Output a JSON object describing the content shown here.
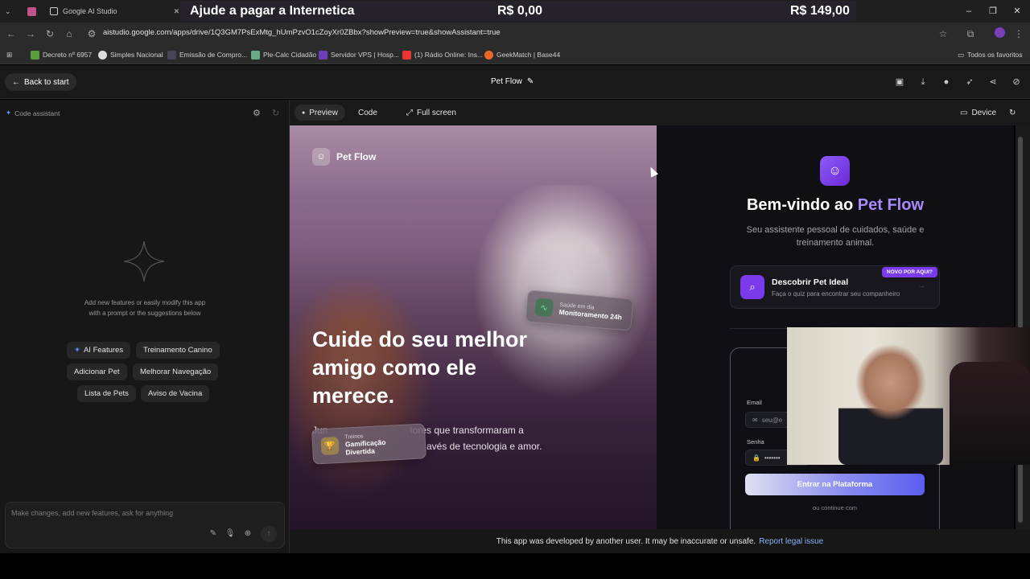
{
  "browser": {
    "tab_title": "Google AI Studio",
    "banner": {
      "text": "Ajude a pagar a Internetica",
      "amount1": "R$ 0,00",
      "amount2": "R$ 149,00"
    },
    "url": "aistudio.google.com/apps/drive/1Q3GM7PsExMtg_hUmPzvO1cZoyXr0ZBbx?showPreview=true&showAssistant=true",
    "bookmarks": [
      "Decreto nº 6957",
      "Simples Nacional",
      "Emissão de Compro...",
      "Ple-Calc Cidadão",
      "Servidor VPS | Hosp...",
      "(1) Rádio Online: Ins...",
      "GeekMatch | Base44"
    ],
    "all_bookmarks": "Todos os favoritos"
  },
  "app": {
    "back_label": "Back to start",
    "title": "Pet Flow"
  },
  "left": {
    "assistant_label": "Code assistant",
    "empty_text": "Add new features or easily modify this app with a prompt or the suggestions below",
    "chips": [
      "AI Features",
      "Treinamento Canino",
      "Adicionar Pet",
      "Melhorar Navegação",
      "Lista de Pets",
      "Aviso de Vacina"
    ],
    "prompt_placeholder": "Make changes, add new features, ask for anything"
  },
  "toolbar": {
    "preview": "Preview",
    "code": "Code",
    "fullscreen": "Full screen",
    "device": "Device"
  },
  "preview": {
    "brand": "Pet Flow",
    "hero": "Cuide do seu melhor amigo como ele merece.",
    "hero_sub_start": "Jun",
    "hero_sub_end": "tores que transformaram a",
    "hero_sub_end2": "avés de tecnologia e amor.",
    "card1_small": "Saúde em dia",
    "card1_big": "Monitoramento 24h",
    "card2_small": "Treinos",
    "card2_big": "Gamificação Divertida",
    "welcome_prefix": "Bem-vindo ao ",
    "welcome_accent": "Pet Flow",
    "welcome_sub": "Seu assistente pessoal de cuidados, saúde e treinamento animal.",
    "discover_title": "Descobrir Pet Ideal",
    "discover_sub": "Faça o quiz para encontrar seu companheiro",
    "discover_badge": "NOVO POR AQUI?",
    "email_label": "Email",
    "email_ph": "seu@e",
    "password_label": "Senha",
    "password_dots": "•••••••",
    "login_button": "Entrar na Plataforma",
    "or_continue": "ou continue com"
  },
  "notice": {
    "text": "This app was developed by another user. It may be inaccurate or unsafe.",
    "link": "Report legal issue"
  },
  "colors": {
    "accent": "#7c3aed",
    "link": "#8ab4f8"
  }
}
